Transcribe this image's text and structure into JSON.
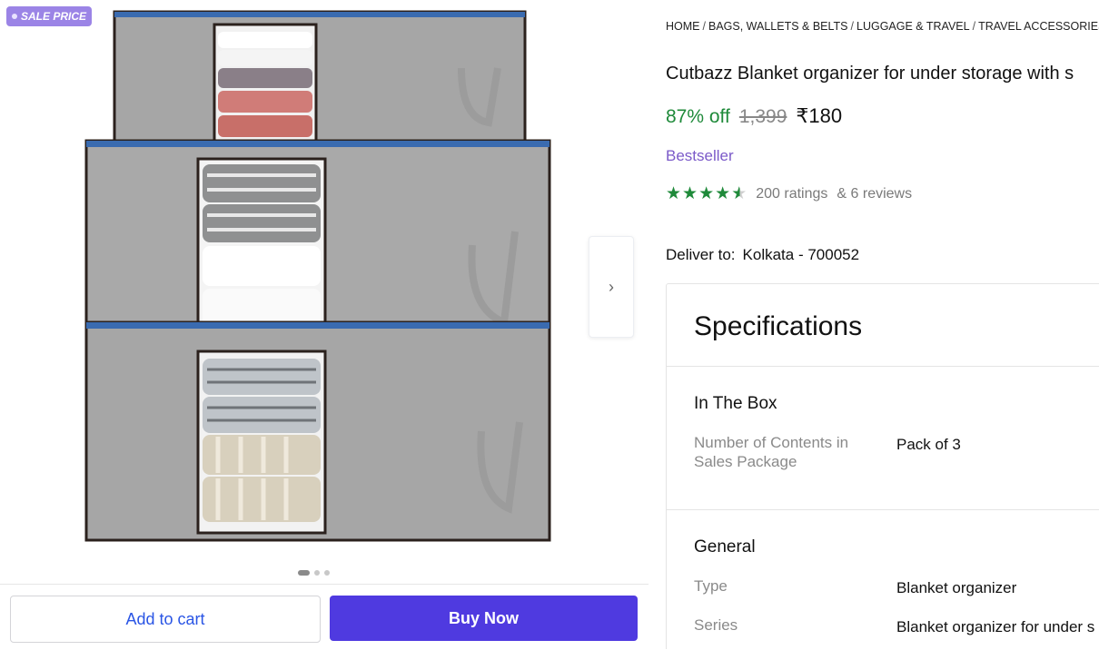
{
  "badge": {
    "label": "SALE PRICE"
  },
  "gallery": {
    "next_icon": "›",
    "slide_count": 3,
    "active_slide": 1
  },
  "actions": {
    "add_to_cart": "Add to cart",
    "buy_now": "Buy Now"
  },
  "breadcrumb": [
    "HOME",
    "BAGS, WALLETS & BELTS",
    "LUGGAGE & TRAVEL",
    "TRAVEL ACCESSORIES"
  ],
  "product": {
    "title": "Cutbazz Blanket organizer for under storage with s",
    "discount": "87% off",
    "mrp": "1,399",
    "price": "₹180",
    "badge": "Bestseller",
    "rating": 4.5,
    "ratings_text": "200 ratings",
    "reviews_text": "& 6 reviews"
  },
  "delivery": {
    "label": "Deliver to:",
    "location": "Kolkata - 700052"
  },
  "specs": {
    "heading": "Specifications",
    "sections": [
      {
        "title": "In The Box",
        "rows": [
          {
            "label": "Number of Contents in Sales Package",
            "value": "Pack of 3"
          }
        ]
      },
      {
        "title": "General",
        "rows": [
          {
            "label": "Type",
            "value": "Blanket organizer"
          },
          {
            "label": "Series",
            "value": "Blanket organizer for under s"
          }
        ]
      }
    ]
  },
  "colors": {
    "accent": "#4f3ae0",
    "discount": "#1f8a3a",
    "bestseller": "#7b5ac9",
    "badge": "#9b84e6"
  }
}
